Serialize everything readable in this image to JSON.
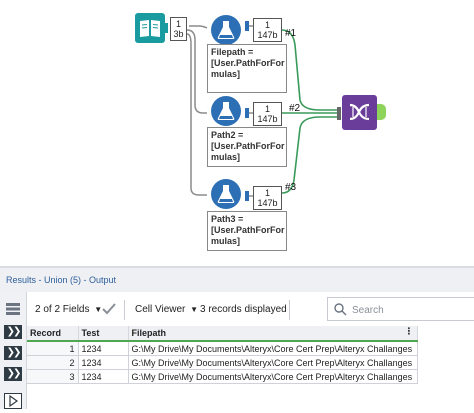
{
  "canvas": {
    "input_tool": {
      "name": "Text Input",
      "anchor_top": "1",
      "anchor_bottom": "3b"
    },
    "formula_tools": [
      {
        "anchor_top": "1",
        "anchor_bottom": "147b",
        "connection_label": "#1",
        "annotation": "Filepath =\n[User.PathForFor\nmulas]"
      },
      {
        "anchor_top": "1",
        "anchor_bottom": "147b",
        "connection_label": "#2",
        "annotation": "Path2 =\n[User.PathForFor\nmulas]"
      },
      {
        "anchor_top": "1",
        "anchor_bottom": "147b",
        "connection_label": "#3",
        "annotation": "Path3 =\n[User.PathForFor\nmulas]"
      }
    ],
    "union_tool": {
      "name": "Union"
    },
    "colors": {
      "input_teal": "#1a9ba0",
      "formula_blue": "#2d6fb4",
      "union_purple": "#6a3d9a",
      "connector_gray": "#8c8c8c",
      "connector_green": "#3a9a5a",
      "output_anchor_green": "#8fd45a"
    }
  },
  "results": {
    "title": "Results - Union (5) - Output",
    "fields_selector": "2 of 2 Fields",
    "viewer_selector": "Cell Viewer",
    "records_status": "3 records displayed",
    "search_placeholder": "Search",
    "columns": [
      "Record",
      "Test",
      "Filepath"
    ],
    "rows": [
      {
        "record": "1",
        "test": "1234",
        "filepath": "G:\\My Drive\\My Documents\\Alteryx\\Core Cert Prep\\Alteryx Challanges"
      },
      {
        "record": "2",
        "test": "1234",
        "filepath": "G:\\My Drive\\My Documents\\Alteryx\\Core Cert Prep\\Alteryx Challanges"
      },
      {
        "record": "3",
        "test": "1234",
        "filepath": "G:\\My Drive\\My Documents\\Alteryx\\Core Cert Prep\\Alteryx Challanges"
      }
    ],
    "icons": {
      "fields": "chevron-down-icon",
      "apply": "checkmark-icon",
      "viewer": "chevron-down-icon",
      "search": "search-icon",
      "column_menu": "more-vertical-icon",
      "row_nav": "double-chevron-right-icon"
    }
  }
}
